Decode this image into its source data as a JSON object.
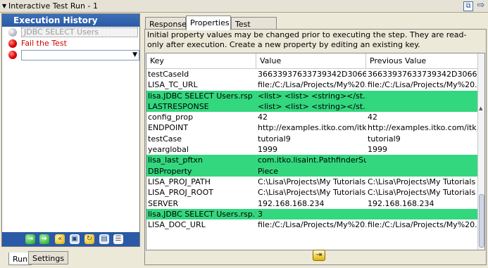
{
  "window": {
    "title": "Interactive Test Run - 1"
  },
  "history": {
    "header": "Execution History",
    "steps": [
      {
        "label": "JDBC SELECT Users",
        "status": "grey"
      },
      {
        "label": "Fail the Test",
        "status": "red"
      }
    ],
    "next_step_value": ""
  },
  "toolbar": {
    "icons": [
      "execute-step-icon",
      "go-icon",
      "rewind-icon",
      "save-icon",
      "refresh-icon",
      "delete-icon",
      "properties-icon"
    ]
  },
  "bottom_tabs": [
    "Run",
    "Settings"
  ],
  "tabs": [
    "Response",
    "Properties",
    "Test Events"
  ],
  "selected_tab": "Properties",
  "properties": {
    "description": "Initial property values may be changed prior to executing the step. They are read-only after execution. Create a new property by editing an existing key.",
    "columns": [
      "Key",
      "Value",
      "Previous Value"
    ],
    "rows": [
      {
        "key": "testCaseId",
        "value": "36633937633739342D30666...",
        "previous": "36633937633739342D30666...",
        "highlight": false
      },
      {
        "key": "LISA_TC_URL",
        "value": "file:/C:/Lisa/Projects/My%20...",
        "previous": "file:/C:/Lisa/Projects/My%20...",
        "highlight": false
      },
      {
        "key": "lisa.JDBC SELECT Users.rsp",
        "value": "<list>   <list>    <string></st...",
        "previous": "",
        "highlight": true
      },
      {
        "key": "LASTRESPONSE",
        "value": "<list>   <list>    <string></st...",
        "previous": "",
        "highlight": true
      },
      {
        "key": "config_prop",
        "value": "42",
        "previous": "42",
        "highlight": false
      },
      {
        "key": "ENDPOINT",
        "value": "http://examples.itko.com/itk...",
        "previous": "http://examples.itko.com/itk...",
        "highlight": false
      },
      {
        "key": "testCase",
        "value": "tutorial9",
        "previous": "tutorial9",
        "highlight": false
      },
      {
        "key": "yearglobal",
        "value": "1999",
        "previous": "1999",
        "highlight": false
      },
      {
        "key": "lisa_last_pftxn",
        "value": "com.itko.lisaint.PathfinderSu...",
        "previous": "",
        "highlight": true
      },
      {
        "key": "DBProperty",
        "value": "Piece",
        "previous": "",
        "highlight": true
      },
      {
        "key": "LISA_PROJ_PATH",
        "value": "C:\\Lisa\\Projects\\My Tutorials",
        "previous": "C:\\Lisa\\Projects\\My Tutorials",
        "highlight": false
      },
      {
        "key": "LISA_PROJ_ROOT",
        "value": "C:\\Lisa\\Projects\\My Tutorials",
        "previous": "C:\\Lisa\\Projects\\My Tutorials",
        "highlight": false
      },
      {
        "key": "SERVER",
        "value": "192.168.168.234",
        "previous": "192.168.168.234",
        "highlight": false
      },
      {
        "key": "lisa.JDBC SELECT Users.rsp.t...",
        "value": "3",
        "previous": "",
        "highlight": true
      },
      {
        "key": "LISA_DOC_URL",
        "value": "file:/C:/Lisa/Projects/My%20...",
        "previous": "file:/C:/Lisa/Projects/My%20...",
        "highlight": false
      }
    ]
  },
  "colors": {
    "highlight": "#33d77e",
    "header": "#2a5aa6",
    "fail": "#d40000"
  }
}
